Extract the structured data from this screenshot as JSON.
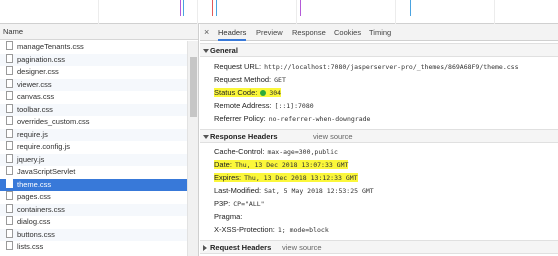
{
  "file_list": {
    "header": "Name",
    "items": [
      "manageTenants.css",
      "pagination.css",
      "designer.css",
      "viewer.css",
      "canvas.css",
      "toolbar.css",
      "overrides_custom.css",
      "require.js",
      "require.config.js",
      "jquery.js",
      "JavaScriptServlet",
      "theme.css",
      "pages.css",
      "containers.css",
      "dialog.css",
      "buttons.css",
      "lists.css"
    ],
    "selected": "theme.css"
  },
  "tabs": [
    "Headers",
    "Preview",
    "Response",
    "Cookies",
    "Timing"
  ],
  "active_tab": "Headers",
  "close_icon": "×",
  "general": {
    "title": "General",
    "request_url_label": "Request URL:",
    "request_url": "http://localhost:7080/jasperserver-pro/_themes/869A68F9/theme.css",
    "request_method_label": "Request Method:",
    "request_method": "GET",
    "status_code_label": "Status Code:",
    "status_code": "304",
    "remote_address_label": "Remote Address:",
    "remote_address": "[::1]:7080",
    "referrer_policy_label": "Referrer Policy:",
    "referrer_policy": "no-referrer-when-downgrade"
  },
  "response_headers": {
    "title": "Response Headers",
    "view_source": "view source",
    "rows": [
      {
        "key": "Cache-Control:",
        "value": "max-age=300,public"
      },
      {
        "key": "Date:",
        "value": "Thu, 13 Dec 2018 13:07:33 GMT"
      },
      {
        "key": "Expires:",
        "value": "Thu, 13 Dec 2018 13:12:33 GMT"
      },
      {
        "key": "Last-Modified:",
        "value": "Sat, 5 May 2018 12:53:25 GMT"
      },
      {
        "key": "P3P:",
        "value": "CP=\"ALL\""
      },
      {
        "key": "Pragma:",
        "value": ""
      },
      {
        "key": "X-XSS-Protection:",
        "value": "1; mode=block"
      }
    ]
  },
  "request_headers": {
    "title": "Request Headers",
    "view_source": "view source"
  },
  "colors": {
    "selection": "#3879d9",
    "highlight": "#fbf73a",
    "status_ok": "#2eaa3a"
  }
}
